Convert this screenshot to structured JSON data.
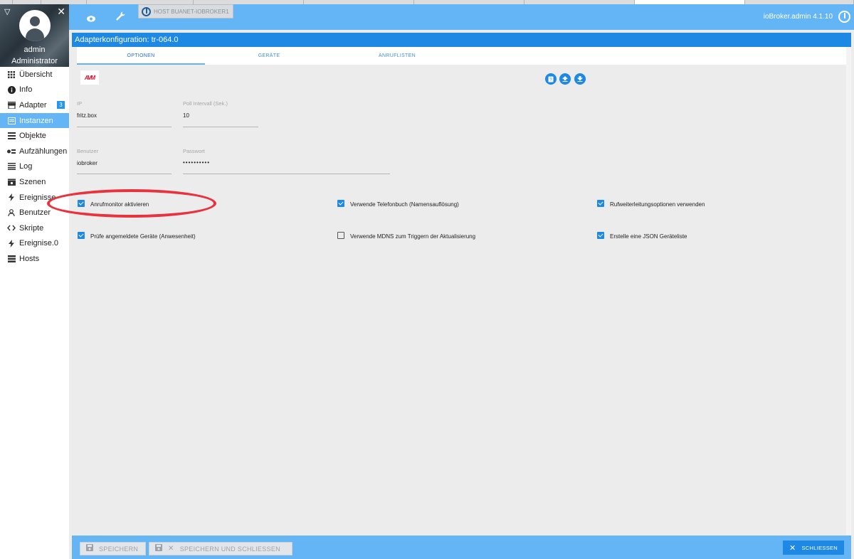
{
  "sidebar": {
    "user": {
      "name": "admin",
      "role": "Administrator"
    },
    "items": [
      {
        "label": "Übersicht",
        "icon": "grid-icon"
      },
      {
        "label": "Info",
        "icon": "info-icon"
      },
      {
        "label": "Adapter",
        "icon": "store-icon",
        "badge": "3"
      },
      {
        "label": "Instanzen",
        "icon": "instances-icon",
        "active": true
      },
      {
        "label": "Objekte",
        "icon": "list-icon"
      },
      {
        "label": "Aufzählungen",
        "icon": "enum-icon"
      },
      {
        "label": "Log",
        "icon": "log-icon"
      },
      {
        "label": "Szenen",
        "icon": "scenes-icon"
      },
      {
        "label": "Ereignisse",
        "icon": "bolt-icon"
      },
      {
        "label": "Benutzer",
        "icon": "user-icon"
      },
      {
        "label": "Skripte",
        "icon": "code-icon"
      },
      {
        "label": "Ereignise.0",
        "icon": "bolt-icon"
      },
      {
        "label": "Hosts",
        "icon": "hosts-icon"
      }
    ]
  },
  "topbar": {
    "host_tab": "HOST BUANET-IOBROKER1",
    "version": "ioBroker.admin 4.1.10"
  },
  "dialog": {
    "title": "Adapterkonfiguration: tr-064.0",
    "tabs": [
      "OPTIONEN",
      "GERÄTE",
      "ANRUFLISTEN"
    ],
    "logo_text": "AVM",
    "fields": {
      "ip": {
        "label": "IP",
        "value": "fritz.box"
      },
      "poll": {
        "label": "Poll Intervall (Sek.)",
        "value": "10"
      },
      "user": {
        "label": "Benutzer",
        "value": "iobroker"
      },
      "password": {
        "label": "Passwort",
        "value": "••••••••••"
      }
    },
    "checkboxes": [
      {
        "label": "Anrufmonitor aktivieren",
        "checked": true
      },
      {
        "label": "Verwende Telefonbuch (Namensauflösung)",
        "checked": true
      },
      {
        "label": "Rufweiterleitungsoptionen verwenden",
        "checked": true
      },
      {
        "label": "Prüfe angemeldete Geräte (Anwesenheit)",
        "checked": true
      },
      {
        "label": "Verwende MDNS zum Triggern der Aktualisierung",
        "checked": false
      },
      {
        "label": "Erstelle eine JSON Geräteliste",
        "checked": true
      }
    ]
  },
  "footer": {
    "save": "SPEICHERN",
    "save_close": "SPEICHERN UND SCHLIESSEN",
    "close": "SCHLIESSEN"
  },
  "colors": {
    "accent": "#64b5f6",
    "primary": "#1e88e5",
    "annotation": "#e8323e"
  }
}
